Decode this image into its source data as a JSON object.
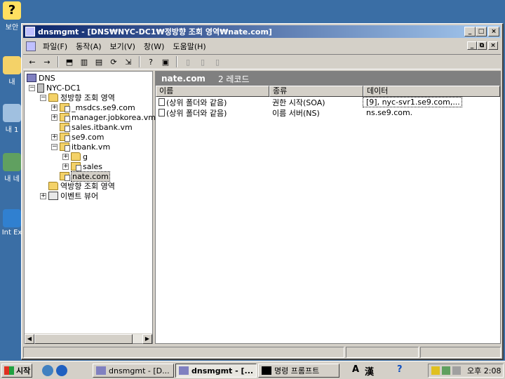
{
  "desktop": {
    "icons": [
      {
        "label": "보안",
        "icon": "help-icon"
      },
      {
        "label": "내",
        "icon": "folder-icon"
      },
      {
        "label": "내 1",
        "icon": "computer-icon"
      },
      {
        "label": "내 네",
        "icon": "network-icon"
      },
      {
        "label": "Int Ex",
        "icon": "ie-icon"
      }
    ]
  },
  "window": {
    "title": "dnsmgmt - [DNS₩NYC-DC1₩정방향 조회 영역₩nate.com]",
    "btn_minimize": "_",
    "btn_maximize": "□",
    "btn_close": "×"
  },
  "menubar": {
    "items": [
      "파일(F)",
      "동작(A)",
      "보기(V)",
      "창(W)",
      "도움말(H)"
    ],
    "mdi_minimize": "_",
    "mdi_restore": "⧉",
    "mdi_close": "×"
  },
  "toolbar": {
    "back": "←",
    "forward": "→",
    "up": "⬒",
    "show_tree": "▥",
    "properties": "▤",
    "refresh": "⟳",
    "export": "⇲",
    "help": "?",
    "console": "▣",
    "new_record": "▯",
    "new_record2": "▯",
    "new_other": "▯"
  },
  "tree": {
    "root": "DNS",
    "server": "NYC-DC1",
    "forward_zones": "정방향 조회 영역",
    "zones": [
      "_msdcs.se9.com",
      "manager.jobkorea.vm",
      "sales.itbank.vm",
      "se9.com",
      "itbank.vm"
    ],
    "sub_g": "g",
    "sub_sales": "sales",
    "selected_zone": "nate.com",
    "reverse_zones": "역방향 조회 영역",
    "event_viewer": "이벤트 뷰어",
    "plus": "+",
    "minus": "−"
  },
  "detail": {
    "zone_name": "nate.com",
    "record_count": "2 레코드",
    "columns": [
      "이름",
      "종류",
      "데이터"
    ],
    "rows": [
      {
        "name": "(상위 폴더와 같음)",
        "type": "권한 시작(SOA)",
        "data": "[9], nyc-svr1.se9.com,..."
      },
      {
        "name": "(상위 폴더와 같음)",
        "type": "이름 서버(NS)",
        "data": "ns.se9.com."
      }
    ]
  },
  "taskbar": {
    "start": "시작",
    "tasks": [
      {
        "label": "dnsmgmt - [D...",
        "active": false
      },
      {
        "label": "dnsmgmt - [...",
        "active": true
      },
      {
        "label": "명령 프롬프트",
        "active": false
      }
    ],
    "ime_a": "A",
    "ime_han": "漢",
    "help": "?",
    "clock": "오후 2:08"
  },
  "colors": {
    "desktop": "#3a6ea5",
    "title_start": "#0a246a",
    "title_end": "#a6caf0",
    "face": "#d4d0c8"
  }
}
